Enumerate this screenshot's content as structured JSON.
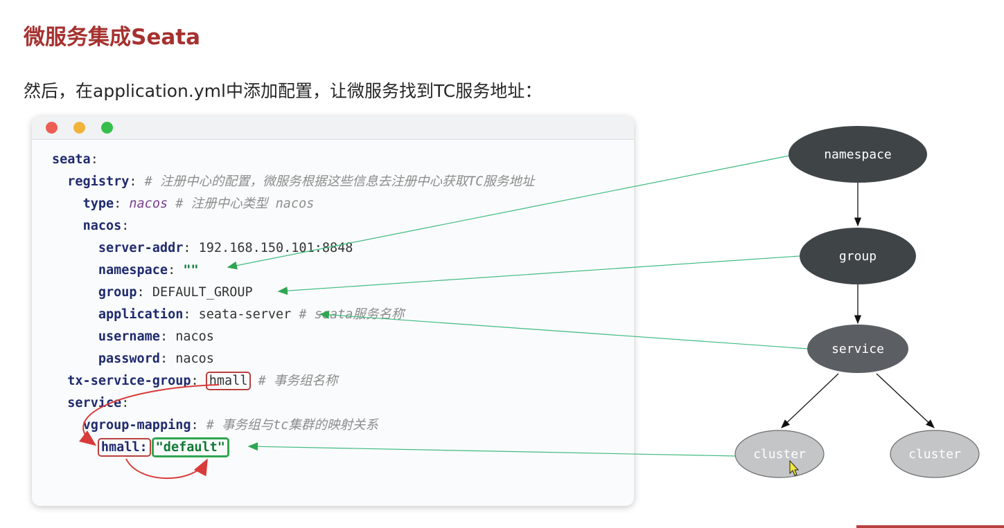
{
  "slide": {
    "title": "微服务集成Seata",
    "subtitle": "然后，在application.yml中添加配置，让微服务找到TC服务地址："
  },
  "code": {
    "lines": [
      {
        "indent": 0,
        "key": "seata",
        "sep": ":"
      },
      {
        "indent": 1,
        "key": "registry",
        "sep": ":",
        "comment": " # 注册中心的配置，微服务根据这些信息去注册中心获取TC服务地址"
      },
      {
        "indent": 2,
        "key": "type",
        "sep": ": ",
        "value": "nacos",
        "comment": " # 注册中心类型 nacos"
      },
      {
        "indent": 2,
        "key": "nacos",
        "sep": ":"
      },
      {
        "indent": 3,
        "key": "server-addr",
        "sep": ": ",
        "value": "192.168.150.101:8848"
      },
      {
        "indent": 3,
        "key": "namespace",
        "sep": ": ",
        "value": "\"\""
      },
      {
        "indent": 3,
        "key": "group",
        "sep": ": ",
        "value": "DEFAULT_GROUP"
      },
      {
        "indent": 3,
        "key": "application",
        "sep": ": ",
        "value": "seata-server",
        "comment": " # seata服务名称"
      },
      {
        "indent": 3,
        "key": "username",
        "sep": ": ",
        "value": "nacos"
      },
      {
        "indent": 3,
        "key": "password",
        "sep": ": ",
        "value": "nacos"
      },
      {
        "indent": 1,
        "key": "tx-service-group",
        "sep": ": ",
        "value": "hmall",
        "comment": " # 事务组名称"
      },
      {
        "indent": 1,
        "key": "service",
        "sep": ":"
      },
      {
        "indent": 2,
        "key": "vgroup-mapping",
        "sep": ":",
        "comment": " # 事务组与tc集群的映射关系"
      },
      {
        "indent": 3,
        "key": "hmall",
        "sep": ": ",
        "value": "\"default\""
      }
    ]
  },
  "diagram": {
    "nodes": {
      "namespace": "namespace",
      "group": "group",
      "service": "service",
      "cluster_left": "cluster",
      "cluster_right": "cluster"
    }
  },
  "colors": {
    "title": "#a5312f",
    "node_dark": "#3f4447",
    "node_mid": "#5b5f63",
    "node_light": "#c4c5c6",
    "arrow_green": "#3dbb7e",
    "highlight_red": "#b8403f",
    "highlight_green": "#2ea64f"
  }
}
